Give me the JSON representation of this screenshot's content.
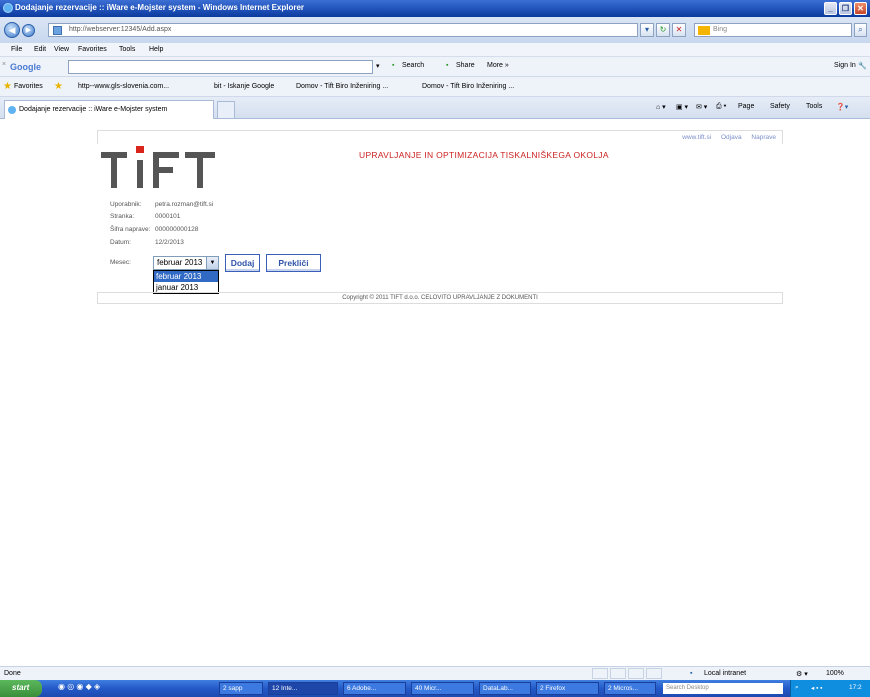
{
  "window": {
    "title": "Dodajanje rezervacije :: iWare e-Mojster system - Windows Internet Explorer"
  },
  "browser": {
    "address": "http://webserver:12345/Add.aspx",
    "search_placeholder": "Bing",
    "menu": [
      "File",
      "Edit",
      "View",
      "Favorites",
      "Tools",
      "Help"
    ],
    "google": {
      "logo": "Google",
      "search_label": "Search",
      "share_label": "Share",
      "more_label": "More »",
      "signin_label": "Sign In"
    },
    "favorites": {
      "label": "Favorites",
      "items": [
        "http--www.gls-slovenia.com...",
        "bit - Iskanje Google",
        "Domov - Tift Biro Inženiring ...",
        "Domov - Tift Biro Inženiring ..."
      ]
    },
    "tab_title": "Dodajanje rezervacije :: iWare e-Mojster system",
    "commands": [
      "Page",
      "Safety",
      "Tools"
    ]
  },
  "page": {
    "links": [
      "www.tift.si",
      "Odjava",
      "Naprave"
    ],
    "headline": "UPRAVLJANJE IN OPTIMIZACIJA TISKALNIŠKEGA OKOLJA",
    "logo_text": "TiFT",
    "fields": [
      {
        "label": "Uporabnik:",
        "value": "petra.rozman@tift.si"
      },
      {
        "label": "Stranka:",
        "value": "0000101"
      },
      {
        "label": "Šifra naprave:",
        "value": "000000000128"
      },
      {
        "label": "Datum:",
        "value": "12/2/2013"
      },
      {
        "label": "Mesec:",
        "value": ""
      }
    ],
    "month_select": {
      "value": "februar 2013",
      "options": [
        "februar 2013",
        "januar 2013"
      ]
    },
    "add_button": "Dodaj",
    "cancel_button": "Prekliči",
    "copyright": "Copyright © 2011 TIFT d.o.o. CELOVITO UPRAVLJANJE Z DOKUMENTI"
  },
  "status": {
    "left": "Done",
    "zone": "Local intranet",
    "zoom": "100%"
  },
  "taskbar": {
    "start": "start",
    "items": [
      "2 sapp",
      "12 Inte...",
      "6 Adobe...",
      "40 Micr...",
      "DataLab...",
      "2 Firefox",
      "2 Micros..."
    ],
    "search_placeholder": "Search Desktop",
    "clock": "17:2"
  }
}
